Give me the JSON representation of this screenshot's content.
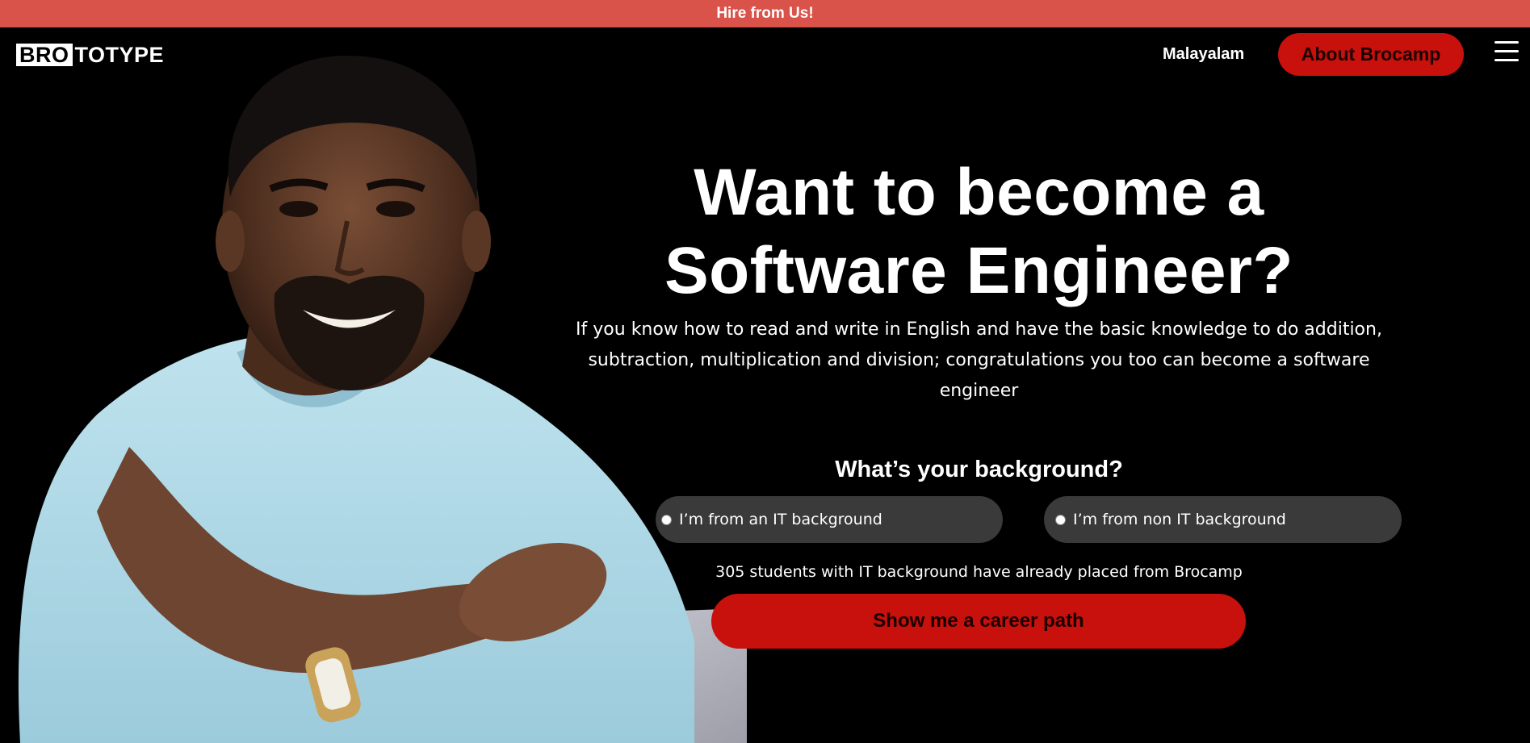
{
  "topbar": {
    "link_text": "Hire from Us!"
  },
  "nav": {
    "logo_box": "BRO",
    "logo_rest": "TOTYPE",
    "language_label": "Malayalam",
    "about_label": "About Brocamp",
    "menu_icon": "hamburger-menu-icon"
  },
  "hero": {
    "title_line1": "Want to become a",
    "title_line2": "Software Engineer?",
    "subtitle": "If you know how to read and write in English and have the basic knowledge to do addition, subtraction, multiplication and division; congratulations you too can become a software engineer"
  },
  "background": {
    "question": "What’s your background?",
    "options": [
      {
        "label": "I’m from an IT background",
        "selected": false
      },
      {
        "label": "I’m from non IT background",
        "selected": false
      }
    ],
    "stat_text": "305 students with IT background have already placed from Brocamp"
  },
  "cta": {
    "label": "Show me a career path"
  },
  "colors": {
    "accent_red": "#c8100d",
    "topbar": "#d9534a",
    "background": "#000000",
    "option_bg": "#3a3a3a"
  }
}
